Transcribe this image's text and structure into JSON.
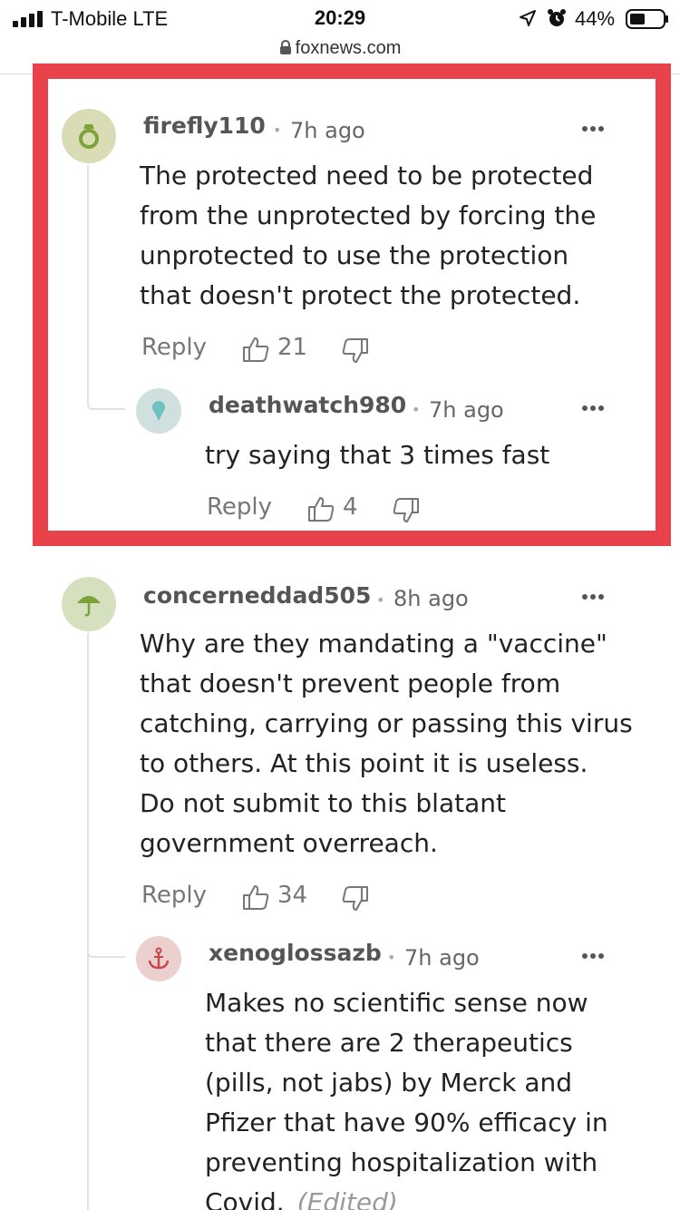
{
  "status_bar": {
    "carrier": "T-Mobile  LTE",
    "time": "20:29",
    "battery": "44%",
    "url": "foxnews.com"
  },
  "colors": {
    "highlight": "#e8434a",
    "thread_line": "#e2e2e2"
  },
  "comments": [
    {
      "username": "firefly110",
      "time": "7h ago",
      "avatar_icon": "ring-icon",
      "avatar_bg": "#d9dcb4",
      "text": "The protected need to be protected\nfrom the unprotected by forcing the\nunprotected to use the protection\nthat doesn't protect the protected.",
      "reply_label": "Reply",
      "likes": "21",
      "replies": [
        {
          "username": "deathwatch980",
          "time": "7h ago",
          "avatar_icon": "ice-cream-icon",
          "avatar_bg": "#cfe0df",
          "text": "try saying that 3 times fast",
          "reply_label": "Reply",
          "likes": "4"
        }
      ]
    },
    {
      "username": "concerneddad505",
      "time": "8h ago",
      "avatar_icon": "umbrella-icon",
      "avatar_bg": "#d5e0bf",
      "text": "Why are they mandating a \"vaccine\"\nthat doesn't prevent people from\ncatching, carrying or passing this virus\nto others. At this point it is useless.\nDo not submit to this blatant\ngovernment overreach.",
      "reply_label": "Reply",
      "likes": "34",
      "replies": [
        {
          "username": "xenoglossazb",
          "time": "7h ago",
          "avatar_icon": "anchor-icon",
          "avatar_bg": "#ecd0d0",
          "text": "Makes no scientific sense now\nthat there are 2 therapeutics\n(pills, not jabs)  by Merck and\nPfizer that have 90% efficacy in\npreventing hospitalization with\nCovid.",
          "edited_label": "(Edited)"
        }
      ]
    }
  ]
}
